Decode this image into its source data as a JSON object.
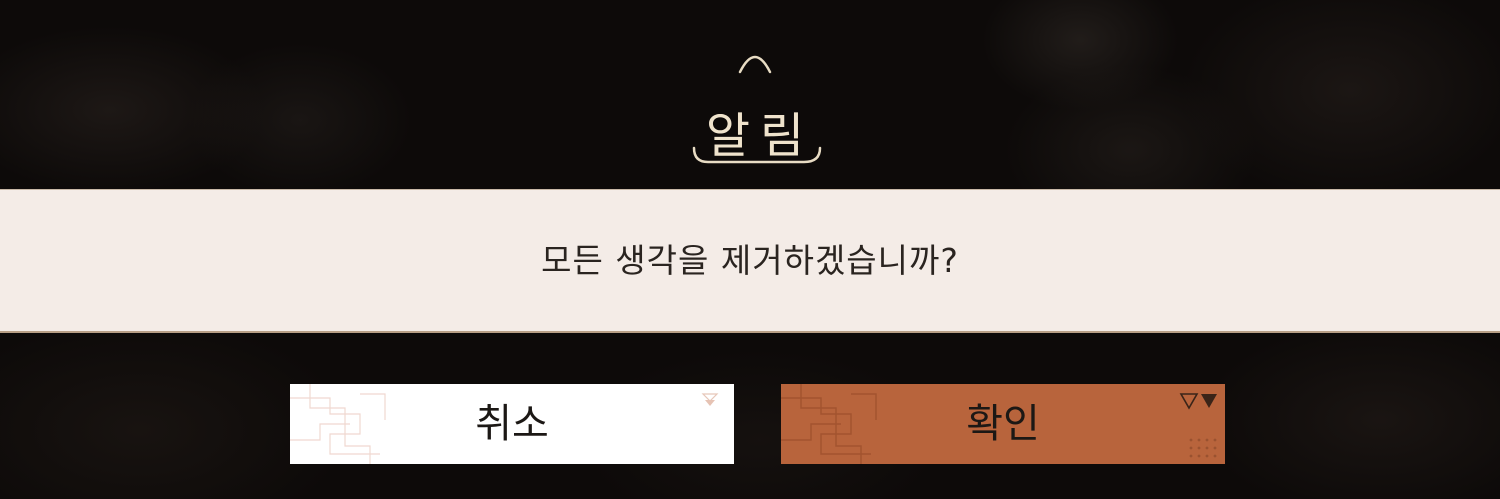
{
  "dialog": {
    "title": "알림",
    "message": "모든 생각을 제거하겠습니까?"
  },
  "buttons": {
    "cancel_label": "취소",
    "confirm_label": "확인"
  },
  "colors": {
    "background": "#0d0a09",
    "title": "#efe3cc",
    "message_band": "#f4ece7",
    "message_text": "#2a2420",
    "cancel_button": "#ffffff",
    "confirm_button": "#b8643c"
  }
}
